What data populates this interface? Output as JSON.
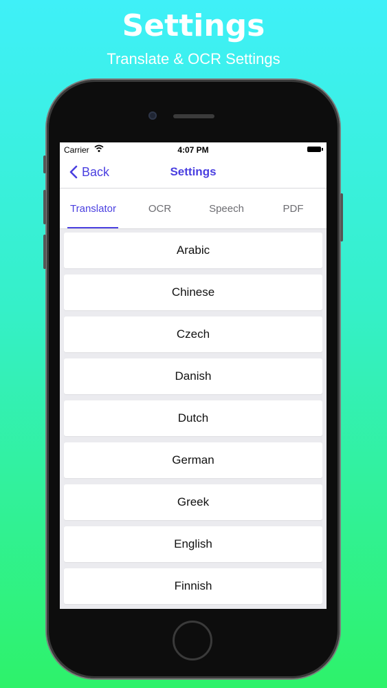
{
  "promo": {
    "title": "Settings",
    "subtitle": "Translate & OCR Settings"
  },
  "status_bar": {
    "carrier": "Carrier",
    "time": "4:07 PM",
    "wifi_icon": "wifi-icon",
    "battery_icon": "battery-icon"
  },
  "nav": {
    "back_label": "Back",
    "back_icon": "chevron-left-icon",
    "title": "Settings"
  },
  "tabs": [
    {
      "label": "Translator",
      "active": true
    },
    {
      "label": "OCR",
      "active": false
    },
    {
      "label": "Speech",
      "active": false
    },
    {
      "label": "PDF",
      "active": false
    }
  ],
  "languages": [
    "Arabic",
    "Chinese",
    "Czech",
    "Danish",
    "Dutch",
    "German",
    "Greek",
    "English",
    "Finnish"
  ],
  "colors": {
    "accent": "#4a3fe0",
    "background_top": "#3ff0f8",
    "background_bottom": "#2ef26a"
  }
}
